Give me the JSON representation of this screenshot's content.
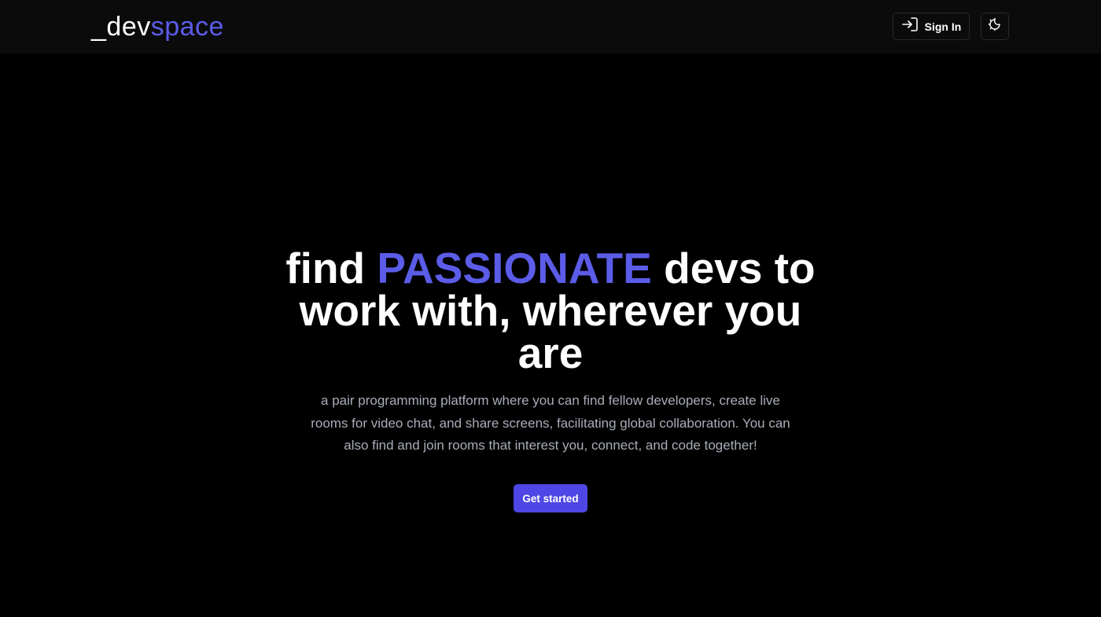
{
  "header": {
    "logo_prefix": "_dev",
    "logo_accent": "space",
    "signin_label": "Sign In",
    "signin_icon": "sign-in-icon",
    "theme_icon": "moon-sun-icon"
  },
  "hero": {
    "title_before": "find ",
    "title_accent": "PASSIONATE",
    "title_after": " devs to work with, wherever you are",
    "subtitle": "a pair programming platform where you can find fellow developers, create live rooms for video chat, and share screens, facilitating global collaboration. You can also find and join rooms that interest you, connect, and code together!",
    "cta_label": "Get started"
  },
  "colors": {
    "accent": "#5b5ce8",
    "button": "#4e46e5",
    "background": "#000000",
    "header_bg": "#0b0b0c",
    "subtitle_text": "#a8adb8"
  }
}
